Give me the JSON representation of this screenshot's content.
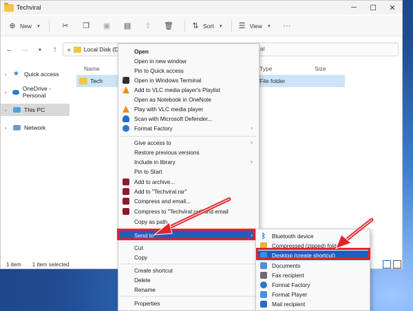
{
  "window": {
    "title": "Techviral",
    "controls": {
      "minimize": "─",
      "maximize": "☐",
      "close": "✕"
    }
  },
  "toolbar": {
    "new_label": "New",
    "sort_label": "Sort",
    "view_label": "View",
    "more": "···"
  },
  "address": {
    "prefix": "«",
    "path": "Local Disk (D:)",
    "tail": "al"
  },
  "sidebar": {
    "items": [
      {
        "label": "Quick access",
        "icon": "star-icon"
      },
      {
        "label": "OneDrive - Personal",
        "icon": "cloud-icon"
      },
      {
        "label": "This PC",
        "icon": "pc-icon"
      },
      {
        "label": "Network",
        "icon": "network-icon"
      }
    ]
  },
  "columns": {
    "name": "Name",
    "type": "Type",
    "size": "Size"
  },
  "file": {
    "name": "Tech",
    "type": "File folder"
  },
  "status": {
    "count": "1 item",
    "selected": "1 item selected"
  },
  "context_menu": {
    "items": [
      {
        "label": "Open",
        "bold": true
      },
      {
        "label": "Open in new window"
      },
      {
        "label": "Pin to Quick access"
      },
      {
        "label": "Open in Windows Terminal",
        "icon": "terminal-icon"
      },
      {
        "label": "Add to VLC media player's Playlist",
        "icon": "vlc-icon"
      },
      {
        "label": "Open as Notebook in OneNote"
      },
      {
        "label": "Play with VLC media player",
        "icon": "vlc-icon"
      },
      {
        "label": "Scan with Microsoft Defender...",
        "icon": "defender-icon"
      },
      {
        "label": "Format Factory",
        "icon": "format-factory-icon",
        "submenu": true
      },
      {
        "label": "Give access to",
        "submenu": true
      },
      {
        "label": "Restore previous versions"
      },
      {
        "label": "Include in library",
        "submenu": true
      },
      {
        "label": "Pin to Start"
      },
      {
        "label": "Add to archive...",
        "icon": "winrar-icon"
      },
      {
        "label": "Add to \"Techviral.rar\"",
        "icon": "winrar-icon"
      },
      {
        "label": "Compress and email...",
        "icon": "winrar-icon"
      },
      {
        "label": "Compress to \"Techviral.rar\" and email",
        "icon": "winrar-icon"
      },
      {
        "label": "Copy as path"
      },
      {
        "label": "Send to",
        "submenu": true,
        "highlighted": true
      },
      {
        "label": "Cut"
      },
      {
        "label": "Copy"
      },
      {
        "label": "Create shortcut"
      },
      {
        "label": "Delete"
      },
      {
        "label": "Rename"
      },
      {
        "label": "Properties"
      }
    ]
  },
  "send_to_menu": {
    "items": [
      {
        "label": "Bluetooth device",
        "icon": "bluetooth-icon"
      },
      {
        "label": "Compressed (zipped) folder",
        "icon": "zip-folder-icon"
      },
      {
        "label": "Desktop (create shortcut)",
        "icon": "desktop-icon",
        "highlighted": true
      },
      {
        "label": "Documents",
        "icon": "documents-icon"
      },
      {
        "label": "Fax recipient",
        "icon": "fax-icon"
      },
      {
        "label": "Format Factory",
        "icon": "format-factory-icon"
      },
      {
        "label": "Format Player",
        "icon": "format-player-icon"
      },
      {
        "label": "Mail recipient",
        "icon": "mail-icon"
      }
    ]
  },
  "colors": {
    "highlight": "#1e5fbf",
    "annotation": "#e3232a",
    "selection": "#cce4f7"
  }
}
